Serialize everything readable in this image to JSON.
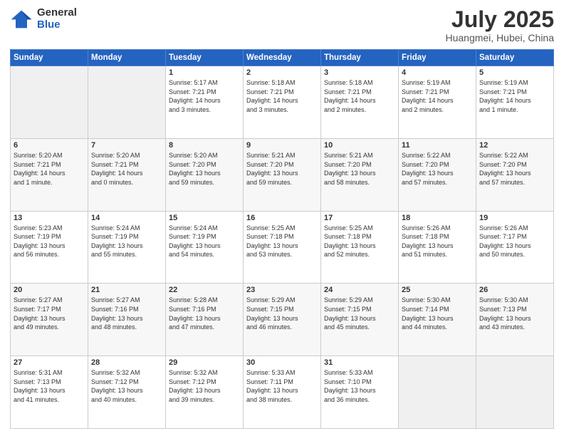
{
  "header": {
    "logo_general": "General",
    "logo_blue": "Blue",
    "month_title": "July 2025",
    "location": "Huangmei, Hubei, China"
  },
  "days_of_week": [
    "Sunday",
    "Monday",
    "Tuesday",
    "Wednesday",
    "Thursday",
    "Friday",
    "Saturday"
  ],
  "weeks": [
    [
      {
        "day": "",
        "info": ""
      },
      {
        "day": "",
        "info": ""
      },
      {
        "day": "1",
        "info": "Sunrise: 5:17 AM\nSunset: 7:21 PM\nDaylight: 14 hours\nand 3 minutes."
      },
      {
        "day": "2",
        "info": "Sunrise: 5:18 AM\nSunset: 7:21 PM\nDaylight: 14 hours\nand 3 minutes."
      },
      {
        "day": "3",
        "info": "Sunrise: 5:18 AM\nSunset: 7:21 PM\nDaylight: 14 hours\nand 2 minutes."
      },
      {
        "day": "4",
        "info": "Sunrise: 5:19 AM\nSunset: 7:21 PM\nDaylight: 14 hours\nand 2 minutes."
      },
      {
        "day": "5",
        "info": "Sunrise: 5:19 AM\nSunset: 7:21 PM\nDaylight: 14 hours\nand 1 minute."
      }
    ],
    [
      {
        "day": "6",
        "info": "Sunrise: 5:20 AM\nSunset: 7:21 PM\nDaylight: 14 hours\nand 1 minute."
      },
      {
        "day": "7",
        "info": "Sunrise: 5:20 AM\nSunset: 7:21 PM\nDaylight: 14 hours\nand 0 minutes."
      },
      {
        "day": "8",
        "info": "Sunrise: 5:20 AM\nSunset: 7:20 PM\nDaylight: 13 hours\nand 59 minutes."
      },
      {
        "day": "9",
        "info": "Sunrise: 5:21 AM\nSunset: 7:20 PM\nDaylight: 13 hours\nand 59 minutes."
      },
      {
        "day": "10",
        "info": "Sunrise: 5:21 AM\nSunset: 7:20 PM\nDaylight: 13 hours\nand 58 minutes."
      },
      {
        "day": "11",
        "info": "Sunrise: 5:22 AM\nSunset: 7:20 PM\nDaylight: 13 hours\nand 57 minutes."
      },
      {
        "day": "12",
        "info": "Sunrise: 5:22 AM\nSunset: 7:20 PM\nDaylight: 13 hours\nand 57 minutes."
      }
    ],
    [
      {
        "day": "13",
        "info": "Sunrise: 5:23 AM\nSunset: 7:19 PM\nDaylight: 13 hours\nand 56 minutes."
      },
      {
        "day": "14",
        "info": "Sunrise: 5:24 AM\nSunset: 7:19 PM\nDaylight: 13 hours\nand 55 minutes."
      },
      {
        "day": "15",
        "info": "Sunrise: 5:24 AM\nSunset: 7:19 PM\nDaylight: 13 hours\nand 54 minutes."
      },
      {
        "day": "16",
        "info": "Sunrise: 5:25 AM\nSunset: 7:18 PM\nDaylight: 13 hours\nand 53 minutes."
      },
      {
        "day": "17",
        "info": "Sunrise: 5:25 AM\nSunset: 7:18 PM\nDaylight: 13 hours\nand 52 minutes."
      },
      {
        "day": "18",
        "info": "Sunrise: 5:26 AM\nSunset: 7:18 PM\nDaylight: 13 hours\nand 51 minutes."
      },
      {
        "day": "19",
        "info": "Sunrise: 5:26 AM\nSunset: 7:17 PM\nDaylight: 13 hours\nand 50 minutes."
      }
    ],
    [
      {
        "day": "20",
        "info": "Sunrise: 5:27 AM\nSunset: 7:17 PM\nDaylight: 13 hours\nand 49 minutes."
      },
      {
        "day": "21",
        "info": "Sunrise: 5:27 AM\nSunset: 7:16 PM\nDaylight: 13 hours\nand 48 minutes."
      },
      {
        "day": "22",
        "info": "Sunrise: 5:28 AM\nSunset: 7:16 PM\nDaylight: 13 hours\nand 47 minutes."
      },
      {
        "day": "23",
        "info": "Sunrise: 5:29 AM\nSunset: 7:15 PM\nDaylight: 13 hours\nand 46 minutes."
      },
      {
        "day": "24",
        "info": "Sunrise: 5:29 AM\nSunset: 7:15 PM\nDaylight: 13 hours\nand 45 minutes."
      },
      {
        "day": "25",
        "info": "Sunrise: 5:30 AM\nSunset: 7:14 PM\nDaylight: 13 hours\nand 44 minutes."
      },
      {
        "day": "26",
        "info": "Sunrise: 5:30 AM\nSunset: 7:13 PM\nDaylight: 13 hours\nand 43 minutes."
      }
    ],
    [
      {
        "day": "27",
        "info": "Sunrise: 5:31 AM\nSunset: 7:13 PM\nDaylight: 13 hours\nand 41 minutes."
      },
      {
        "day": "28",
        "info": "Sunrise: 5:32 AM\nSunset: 7:12 PM\nDaylight: 13 hours\nand 40 minutes."
      },
      {
        "day": "29",
        "info": "Sunrise: 5:32 AM\nSunset: 7:12 PM\nDaylight: 13 hours\nand 39 minutes."
      },
      {
        "day": "30",
        "info": "Sunrise: 5:33 AM\nSunset: 7:11 PM\nDaylight: 13 hours\nand 38 minutes."
      },
      {
        "day": "31",
        "info": "Sunrise: 5:33 AM\nSunset: 7:10 PM\nDaylight: 13 hours\nand 36 minutes."
      },
      {
        "day": "",
        "info": ""
      },
      {
        "day": "",
        "info": ""
      }
    ]
  ]
}
